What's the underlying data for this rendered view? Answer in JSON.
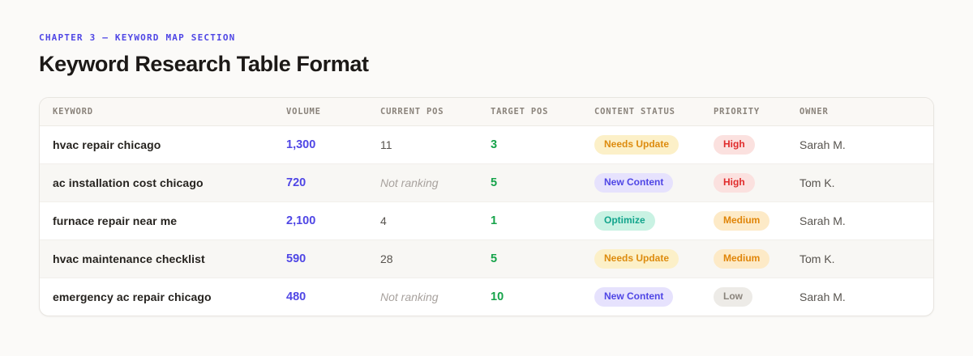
{
  "page": {
    "eyebrow": "CHAPTER 3 — KEYWORD MAP SECTION",
    "title": "Keyword Research Table Format"
  },
  "table": {
    "columns": [
      "KEYWORD",
      "VOLUME",
      "CURRENT POS",
      "TARGET POS",
      "CONTENT STATUS",
      "PRIORITY",
      "OWNER"
    ],
    "rows": [
      {
        "keyword": "hvac repair chicago",
        "volume": "1,300",
        "current_pos": "11",
        "current_pos_muted": false,
        "target_pos": "3",
        "status_label": "Needs Update",
        "status_color": "amber",
        "priority_label": "High",
        "priority_color": "red",
        "owner": "Sarah M."
      },
      {
        "keyword": "ac installation cost chicago",
        "volume": "720",
        "current_pos": "Not ranking",
        "current_pos_muted": true,
        "target_pos": "5",
        "status_label": "New Content",
        "status_color": "purple",
        "priority_label": "High",
        "priority_color": "red",
        "owner": "Tom K."
      },
      {
        "keyword": "furnace repair near me",
        "volume": "2,100",
        "current_pos": "4",
        "current_pos_muted": false,
        "target_pos": "1",
        "status_label": "Optimize",
        "status_color": "teal",
        "priority_label": "Medium",
        "priority_color": "orange",
        "owner": "Sarah M."
      },
      {
        "keyword": "hvac maintenance checklist",
        "volume": "590",
        "current_pos": "28",
        "current_pos_muted": false,
        "target_pos": "5",
        "status_label": "Needs Update",
        "status_color": "amber",
        "priority_label": "Medium",
        "priority_color": "orange",
        "owner": "Tom K."
      },
      {
        "keyword": "emergency ac repair chicago",
        "volume": "480",
        "current_pos": "Not ranking",
        "current_pos_muted": true,
        "target_pos": "10",
        "status_label": "New Content",
        "status_color": "purple",
        "priority_label": "Low",
        "priority_color": "gray",
        "owner": "Sarah M."
      }
    ]
  },
  "colors": {
    "accent_indigo": "#4f46e5",
    "target_green": "#16a34a",
    "page_background": "#fbfaf8",
    "card_background": "#ffffff",
    "card_border": "#e8e5e0"
  }
}
